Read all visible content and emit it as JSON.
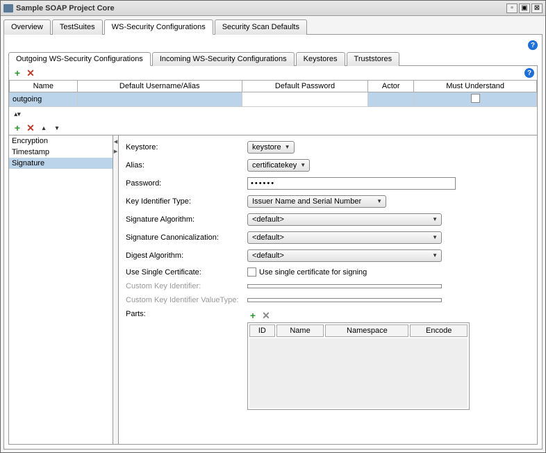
{
  "window": {
    "title": "Sample SOAP Project Core"
  },
  "main_tabs": [
    "Overview",
    "TestSuites",
    "WS-Security Configurations",
    "Security Scan Defaults"
  ],
  "main_tab_active": 2,
  "sub_tabs": [
    "Outgoing WS-Security Configurations",
    "Incoming WS-Security Configurations",
    "Keystores",
    "Truststores"
  ],
  "sub_tab_active": 0,
  "table_headers": [
    "Name",
    "Default Username/Alias",
    "Default Password",
    "Actor",
    "Must Understand"
  ],
  "table_row": {
    "name": "outgoing"
  },
  "entries": [
    "Encryption",
    "Timestamp",
    "Signature"
  ],
  "entry_selected": 2,
  "form": {
    "keystore": {
      "label": "Keystore:",
      "value": "keystore"
    },
    "alias": {
      "label": "Alias:",
      "value": "certificatekey"
    },
    "password": {
      "label": "Password:",
      "value": "••••••"
    },
    "keyid": {
      "label": "Key Identifier Type:",
      "value": "Issuer Name and Serial Number"
    },
    "sigalg": {
      "label": "Signature Algorithm:",
      "value": "<default>"
    },
    "canon": {
      "label": "Signature Canonicalization:",
      "value": "<default>"
    },
    "digest": {
      "label": "Digest Algorithm:",
      "value": "<default>"
    },
    "single": {
      "label": "Use Single Certificate:",
      "chk_label": "Use single certificate for signing"
    },
    "custkey": {
      "label": "Custom Key Identifier:"
    },
    "custval": {
      "label": "Custom Key Identifier ValueType:"
    },
    "parts": {
      "label": "Parts:"
    }
  },
  "parts_headers": [
    "ID",
    "Name",
    "Namespace",
    "Encode"
  ]
}
